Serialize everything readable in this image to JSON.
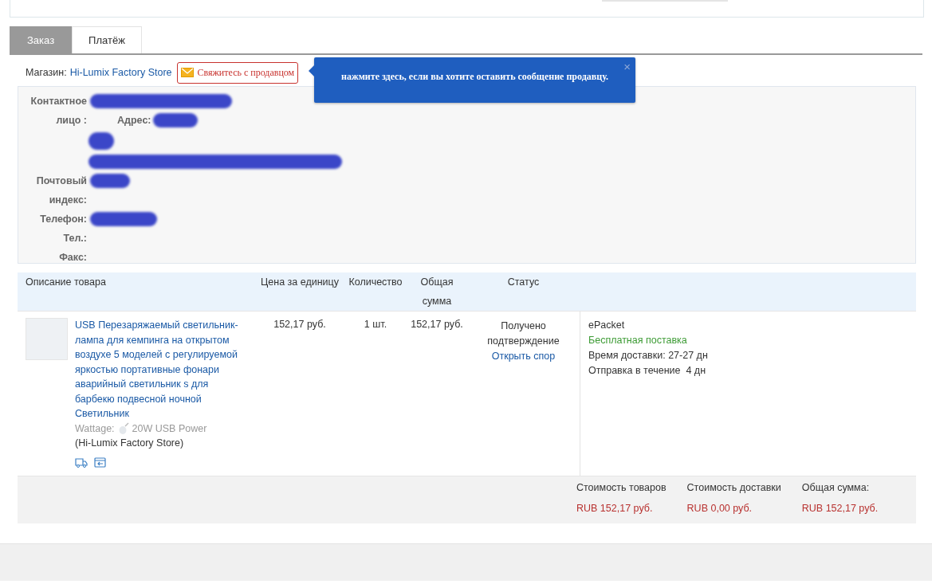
{
  "tabs": [
    {
      "label": "Заказ",
      "selected": true
    },
    {
      "label": "Платёж",
      "selected": false
    }
  ],
  "store": {
    "label": "Магазин:",
    "name": "Hi-Lumix Factory Store",
    "contact_button": "Свяжитесь с продавцом"
  },
  "tooltip": {
    "text": "нажмите здесь, если вы хотите оставить сообщение продавцу.",
    "close": "×"
  },
  "contact": {
    "contact_person_label": "Контактное лицо :",
    "address_label": "Адрес:",
    "postal_code_label": "Почтовый индекс:",
    "phone_label": "Телефон:",
    "tel_label": "Тел.:",
    "fax_label": "Факс:"
  },
  "table": {
    "columns": [
      "Описание товара",
      "Цена за единицу",
      "Количество",
      "Общая сумма",
      "Статус"
    ],
    "rows": [
      {
        "title": "USB Перезаряжаемый светильник-лампа для кемпинга на открытом воздухе 5 моделей с регулируемой яркостью портативные фонари аварийный светильник s для барбекю подвесной ночной Светильник",
        "option_label": "Wattage:",
        "option_value": "20W USB Power",
        "store": "(Hi-Lumix Factory Store)",
        "price": "152,17 руб.",
        "quantity": "1 шт.",
        "total": "152,17 руб.",
        "status": "Получено подтверждение",
        "dispute_link": "Открыть спор",
        "shipping": {
          "method": "ePacket",
          "free": "Бесплатная поставка",
          "delivery_time": "Время доставки: 27-27 дн",
          "dispatch": "Отправка в течение  4 дн"
        }
      }
    ]
  },
  "summary": [
    {
      "label": "Стоимость товаров",
      "value": "RUB 152,17 руб."
    },
    {
      "label": "Стоимость доставки",
      "value": "RUB 0,00 руб."
    },
    {
      "label": "Общая сумма:",
      "value": "RUB 152,17 руб."
    }
  ]
}
